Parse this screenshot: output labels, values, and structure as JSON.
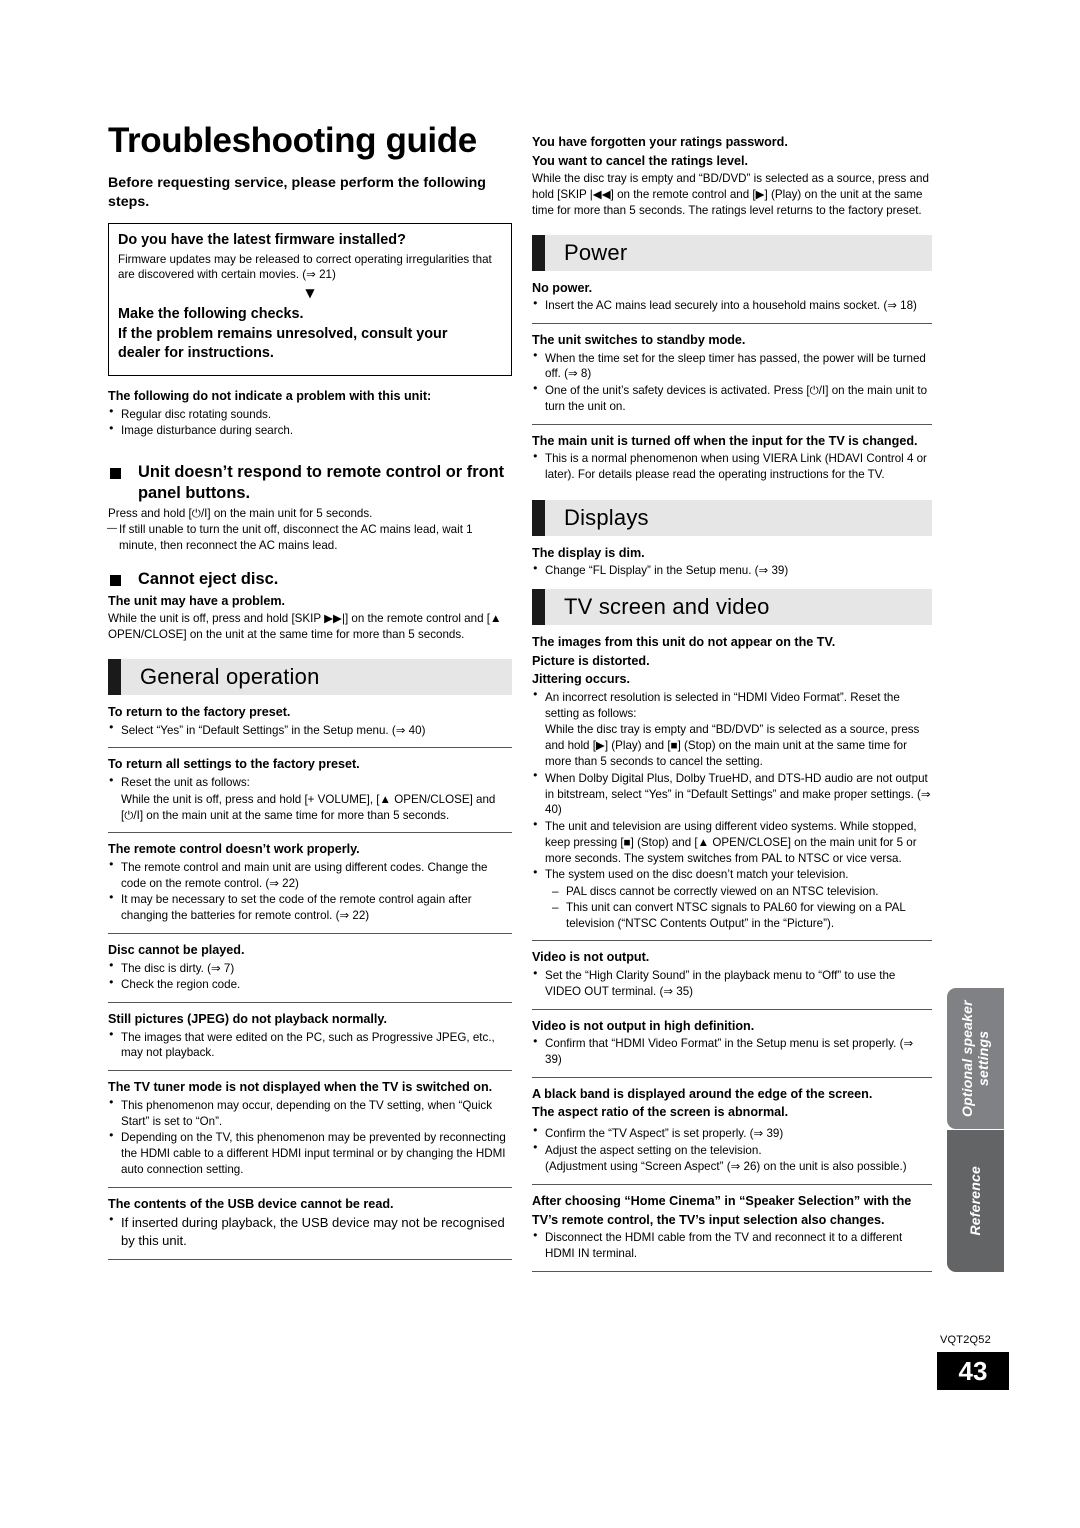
{
  "document": {
    "title": "Troubleshooting guide",
    "lead": "Before requesting service, please perform the following steps.",
    "part_number": "VQT2Q52",
    "page_number": "43"
  },
  "firmware_box": {
    "title": "Do you have the latest firmware installed?",
    "body": "Firmware updates may be released to correct operating irregularities that are discovered with certain movies. (⇒ 21)",
    "arrow": "▼",
    "footer": "Make the following checks.\nIf the problem remains unresolved, consult your dealer for instructions.",
    "footer_line1": "Make the following checks.",
    "footer_line2": "If the problem remains unresolved, consult your",
    "footer_line3": "dealer for instructions."
  },
  "left_column": {
    "no_problem": {
      "heading": "The following do not indicate a problem with this unit:",
      "items": [
        "Regular disc rotating sounds.",
        "Image disturbance during search."
      ]
    },
    "unit_no_respond": {
      "heading": "Unit doesn’t respond to remote control or front panel buttons.",
      "body": "Press and hold [⏻/I] on the main unit for 5 seconds.",
      "dash": "If still unable to turn the unit off, disconnect the AC mains lead, wait 1 minute, then reconnect the AC mains lead."
    },
    "cannot_eject": {
      "heading": "Cannot eject disc.",
      "sub": "The unit may have a problem.",
      "body": "While the unit is off, press and hold [SKIP ▶▶|] on the remote control and [▲ OPEN/CLOSE] on the unit at the same time for more than 5 seconds."
    },
    "section_title": "General operation",
    "entries": [
      {
        "q": "To return to the factory preset.",
        "bullets": [
          "Select “Yes” in “Default Settings” in the Setup menu. (⇒ 40)"
        ]
      },
      {
        "q": "To return all settings to the factory preset.",
        "bullets": [
          "Reset the unit as follows:"
        ],
        "cont": "While the unit is off, press and hold [+ VOLUME], [▲ OPEN/CLOSE] and [⏻/I] on the main unit at the same time for more than 5 seconds."
      },
      {
        "q": "The remote control doesn’t work properly.",
        "bullets": [
          "The remote control and main unit are using different codes. Change the code on the remote control. (⇒ 22)",
          "It may be necessary to set the code of the remote control again after changing the batteries for remote control. (⇒ 22)"
        ]
      },
      {
        "q": "Disc cannot be played.",
        "bullets": [
          "The disc is dirty. (⇒ 7)",
          "Check the region code."
        ]
      },
      {
        "q": "Still pictures (JPEG) do not playback normally.",
        "bullets": [
          "The images that were edited on the PC, such as Progressive JPEG, etc., may not playback."
        ]
      },
      {
        "q": "The TV tuner mode is not displayed when the TV is switched on.",
        "bullets": [
          "This phenomenon may occur, depending on the TV setting, when “Quick Start” is set to “On”.",
          "Depending on the TV, this phenomenon may be prevented by reconnecting the HDMI cable to a different HDMI input terminal or by changing the HDMI auto connection setting."
        ]
      },
      {
        "q": "The contents of the USB device cannot be read.",
        "bullets": [
          "If inserted during playback, the USB device may not be recognised by this unit."
        ]
      }
    ]
  },
  "right_column": {
    "ratings": {
      "heading_line1": "You have forgotten your ratings password.",
      "heading_line2": "You want to cancel the ratings level.",
      "body": "While the disc tray is empty and “BD/DVD” is selected as a source, press and hold [SKIP |◀◀] on the remote control and [▶] (Play) on the unit at the same time for more than 5 seconds. The ratings level returns to the factory preset."
    },
    "power": {
      "title": "Power",
      "entries": [
        {
          "q": "No power.",
          "bullets": [
            "Insert the AC mains lead securely into a household mains socket. (⇒ 18)"
          ]
        },
        {
          "q": "The unit switches to standby mode.",
          "bullets": [
            "When the time set for the sleep timer has passed, the power will be turned off. (⇒ 8)",
            "One of the unit’s safety devices is activated. Press [⏻/I] on the main unit to turn the unit on."
          ]
        },
        {
          "q": "The main unit is turned off when the input for the TV is changed.",
          "bullets": [
            "This is a normal phenomenon when using VIERA Link (HDAVI Control 4 or later). For details please read the operating instructions for the TV."
          ]
        }
      ]
    },
    "displays": {
      "title": "Displays",
      "entries": [
        {
          "q": "The display is dim.",
          "bullets": [
            "Change “FL Display” in the Setup menu. (⇒ 39)"
          ]
        }
      ]
    },
    "tv_screen": {
      "title": "TV screen and video",
      "entries": [
        {
          "q_lines": [
            "The images from this unit do not appear on the TV.",
            "Picture is distorted.",
            "Jittering occurs."
          ],
          "bullets": [
            "An incorrect resolution is selected in “HDMI Video Format”. Reset the setting as follows:",
            "When Dolby Digital Plus, Dolby TrueHD, and DTS-HD audio are not output in bitstream, select “Yes” in “Default Settings” and make proper settings. (⇒ 40)",
            "The unit and television are using different video systems. While stopped, keep pressing [■] (Stop) and [▲ OPEN/CLOSE] on the main unit for 5 or more seconds. The system switches from PAL to NTSC or vice versa.",
            "The system used on the disc doesn’t match your television."
          ],
          "cont_after_first": "While the disc tray is empty and “BD/DVD” is selected as a source, press and hold [▶] (Play) and [■] (Stop) on the main unit at the same time for more than 5 seconds to cancel the setting.",
          "dashes": [
            "PAL discs cannot be correctly viewed on an NTSC television.",
            "This unit can convert NTSC signals to PAL60 for viewing on a PAL television (“NTSC Contents Output” in the “Picture”)."
          ]
        },
        {
          "q": "Video is not output.",
          "bullets": [
            "Set the “High Clarity Sound” in the playback menu to “Off” to use the VIDEO OUT terminal. (⇒ 35)"
          ]
        },
        {
          "q": "Video is not output in high definition.",
          "bullets": [
            "Confirm that “HDMI Video Format” in the Setup menu is set properly. (⇒ 39)"
          ]
        },
        {
          "q_lines": [
            "A black band is displayed around the edge of the screen.",
            "The aspect ratio of the screen is abnormal."
          ],
          "bullets": [
            "Confirm the “TV Aspect” is set properly. (⇒ 39)",
            "Adjust the aspect setting on the television."
          ],
          "cont": "(Adjustment using “Screen Aspect” (⇒ 26) on the unit is also possible.)"
        },
        {
          "q_lines": [
            "After choosing “Home Cinema” in “Speaker Selection” with the",
            "TV’s remote control, the TV’s input selection also changes."
          ],
          "bullets": [
            "Disconnect the HDMI cable from the TV and reconnect it to a different HDMI IN terminal."
          ]
        }
      ]
    }
  },
  "side_tabs": [
    {
      "label": "Optional speaker settings",
      "color": "#808184"
    },
    {
      "label": "Reference",
      "color": "#636466"
    }
  ]
}
